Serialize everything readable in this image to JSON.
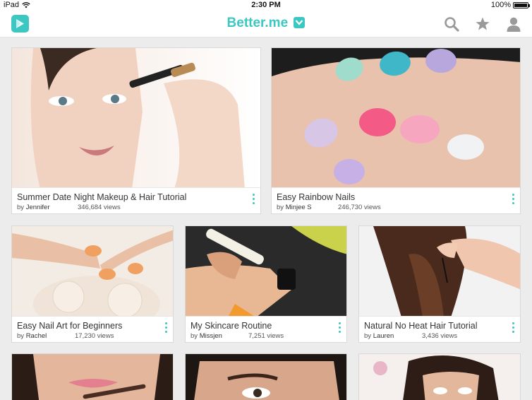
{
  "statusbar": {
    "device": "iPad",
    "time": "2:30 PM",
    "battery": "100%"
  },
  "navbar": {
    "brand": "Better.me",
    "icons": [
      "search-icon",
      "star-icon",
      "user-icon"
    ]
  },
  "colors": {
    "accent": "#3cc7c2"
  },
  "cards": [
    {
      "title": "Summer Date Night Makeup & Hair Tutorial",
      "by": "by",
      "author": "Jennifer",
      "views": "346,684 views"
    },
    {
      "title": "Easy Rainbow Nails",
      "by": "by",
      "author": "Minjee S",
      "views": "246,730 views"
    },
    {
      "title": "Easy Nail Art for Beginners",
      "by": "by",
      "author": "Rachel",
      "views": "17,230 views"
    },
    {
      "title": "My Skincare Routine",
      "by": "by",
      "author": "Missjen",
      "views": "7,251 views"
    },
    {
      "title": "Natural No Heat Hair Tutorial",
      "by": "by",
      "author": "Lauren",
      "views": "3,436 views"
    }
  ]
}
